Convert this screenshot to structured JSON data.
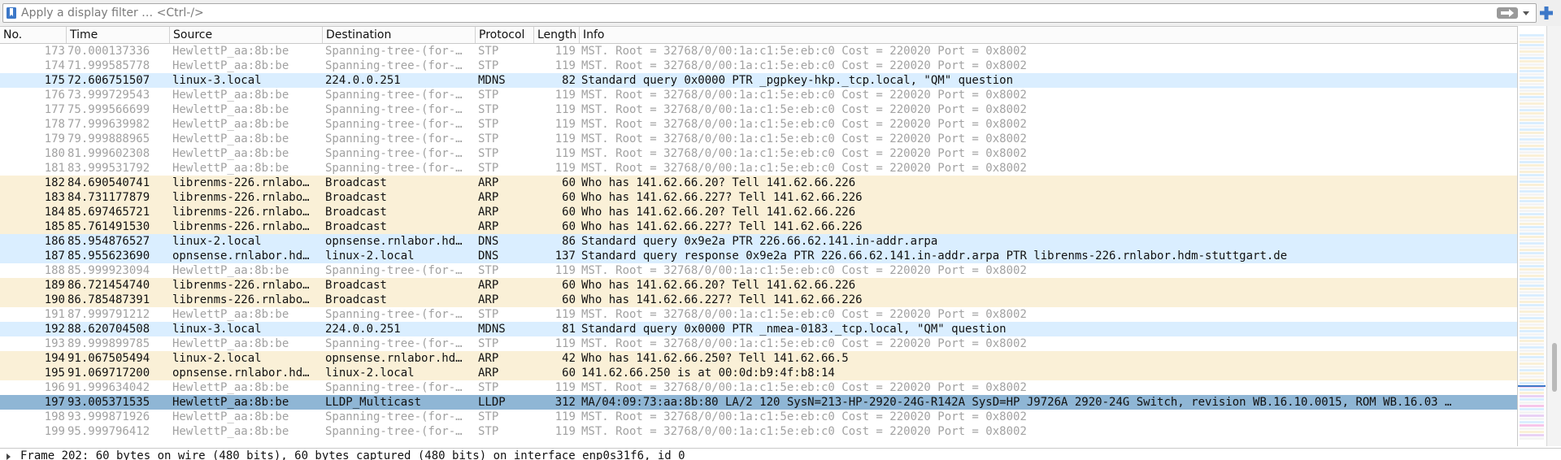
{
  "filter": {
    "placeholder": "Apply a display filter … <Ctrl-/>",
    "value": ""
  },
  "colors": {
    "stp_text": "#a2a2a2",
    "arp_bg": "#faf0d7",
    "udp_bg": "#daeeff",
    "selected_bg": "#8fb6d5"
  },
  "columns": {
    "no": "No.",
    "time": "Time",
    "source": "Source",
    "destination": "Destination",
    "protocol": "Protocol",
    "length": "Length",
    "info": "Info"
  },
  "packets": [
    {
      "no": "173",
      "time": "70.000137336",
      "source": "HewlettP_aa:8b:be",
      "destination": "Spanning-tree-(for-…",
      "protocol": "STP",
      "length": "119",
      "info": "MST. Root = 32768/0/00:1a:c1:5e:eb:c0  Cost = 220020  Port = 0x8002",
      "kind": "stp"
    },
    {
      "no": "174",
      "time": "71.999585778",
      "source": "HewlettP_aa:8b:be",
      "destination": "Spanning-tree-(for-…",
      "protocol": "STP",
      "length": "119",
      "info": "MST. Root = 32768/0/00:1a:c1:5e:eb:c0  Cost = 220020  Port = 0x8002",
      "kind": "stp"
    },
    {
      "no": "175",
      "time": "72.606751507",
      "source": "linux-3.local",
      "destination": "224.0.0.251",
      "protocol": "MDNS",
      "length": "82",
      "info": "Standard query 0x0000 PTR _pgpkey-hkp._tcp.local, \"QM\" question",
      "kind": "udp"
    },
    {
      "no": "176",
      "time": "73.999729543",
      "source": "HewlettP_aa:8b:be",
      "destination": "Spanning-tree-(for-…",
      "protocol": "STP",
      "length": "119",
      "info": "MST. Root = 32768/0/00:1a:c1:5e:eb:c0  Cost = 220020  Port = 0x8002",
      "kind": "stp"
    },
    {
      "no": "177",
      "time": "75.999566699",
      "source": "HewlettP_aa:8b:be",
      "destination": "Spanning-tree-(for-…",
      "protocol": "STP",
      "length": "119",
      "info": "MST. Root = 32768/0/00:1a:c1:5e:eb:c0  Cost = 220020  Port = 0x8002",
      "kind": "stp"
    },
    {
      "no": "178",
      "time": "77.999639982",
      "source": "HewlettP_aa:8b:be",
      "destination": "Spanning-tree-(for-…",
      "protocol": "STP",
      "length": "119",
      "info": "MST. Root = 32768/0/00:1a:c1:5e:eb:c0  Cost = 220020  Port = 0x8002",
      "kind": "stp"
    },
    {
      "no": "179",
      "time": "79.999888965",
      "source": "HewlettP_aa:8b:be",
      "destination": "Spanning-tree-(for-…",
      "protocol": "STP",
      "length": "119",
      "info": "MST. Root = 32768/0/00:1a:c1:5e:eb:c0  Cost = 220020  Port = 0x8002",
      "kind": "stp"
    },
    {
      "no": "180",
      "time": "81.999602308",
      "source": "HewlettP_aa:8b:be",
      "destination": "Spanning-tree-(for-…",
      "protocol": "STP",
      "length": "119",
      "info": "MST. Root = 32768/0/00:1a:c1:5e:eb:c0  Cost = 220020  Port = 0x8002",
      "kind": "stp"
    },
    {
      "no": "181",
      "time": "83.999531792",
      "source": "HewlettP_aa:8b:be",
      "destination": "Spanning-tree-(for-…",
      "protocol": "STP",
      "length": "119",
      "info": "MST. Root = 32768/0/00:1a:c1:5e:eb:c0  Cost = 220020  Port = 0x8002",
      "kind": "stp"
    },
    {
      "no": "182",
      "time": "84.690540741",
      "source": "librenms-226.rnlabo…",
      "destination": "Broadcast",
      "protocol": "ARP",
      "length": "60",
      "info": "Who has 141.62.66.20? Tell 141.62.66.226",
      "kind": "arp"
    },
    {
      "no": "183",
      "time": "84.731177879",
      "source": "librenms-226.rnlabo…",
      "destination": "Broadcast",
      "protocol": "ARP",
      "length": "60",
      "info": "Who has 141.62.66.227? Tell 141.62.66.226",
      "kind": "arp"
    },
    {
      "no": "184",
      "time": "85.697465721",
      "source": "librenms-226.rnlabo…",
      "destination": "Broadcast",
      "protocol": "ARP",
      "length": "60",
      "info": "Who has 141.62.66.20? Tell 141.62.66.226",
      "kind": "arp"
    },
    {
      "no": "185",
      "time": "85.761491530",
      "source": "librenms-226.rnlabo…",
      "destination": "Broadcast",
      "protocol": "ARP",
      "length": "60",
      "info": "Who has 141.62.66.227? Tell 141.62.66.226",
      "kind": "arp"
    },
    {
      "no": "186",
      "time": "85.954876527",
      "source": "linux-2.local",
      "destination": "opnsense.rnlabor.hd…",
      "protocol": "DNS",
      "length": "86",
      "info": "Standard query 0x9e2a PTR 226.66.62.141.in-addr.arpa",
      "kind": "udp"
    },
    {
      "no": "187",
      "time": "85.955623690",
      "source": "opnsense.rnlabor.hd…",
      "destination": "linux-2.local",
      "protocol": "DNS",
      "length": "137",
      "info": "Standard query response 0x9e2a PTR 226.66.62.141.in-addr.arpa PTR librenms-226.rnlabor.hdm-stuttgart.de",
      "kind": "udp"
    },
    {
      "no": "188",
      "time": "85.999923094",
      "source": "HewlettP_aa:8b:be",
      "destination": "Spanning-tree-(for-…",
      "protocol": "STP",
      "length": "119",
      "info": "MST. Root = 32768/0/00:1a:c1:5e:eb:c0  Cost = 220020  Port = 0x8002",
      "kind": "stp"
    },
    {
      "no": "189",
      "time": "86.721454740",
      "source": "librenms-226.rnlabo…",
      "destination": "Broadcast",
      "protocol": "ARP",
      "length": "60",
      "info": "Who has 141.62.66.20? Tell 141.62.66.226",
      "kind": "arp"
    },
    {
      "no": "190",
      "time": "86.785487391",
      "source": "librenms-226.rnlabo…",
      "destination": "Broadcast",
      "protocol": "ARP",
      "length": "60",
      "info": "Who has 141.62.66.227? Tell 141.62.66.226",
      "kind": "arp"
    },
    {
      "no": "191",
      "time": "87.999791212",
      "source": "HewlettP_aa:8b:be",
      "destination": "Spanning-tree-(for-…",
      "protocol": "STP",
      "length": "119",
      "info": "MST. Root = 32768/0/00:1a:c1:5e:eb:c0  Cost = 220020  Port = 0x8002",
      "kind": "stp"
    },
    {
      "no": "192",
      "time": "88.620704508",
      "source": "linux-3.local",
      "destination": "224.0.0.251",
      "protocol": "MDNS",
      "length": "81",
      "info": "Standard query 0x0000 PTR _nmea-0183._tcp.local, \"QM\" question",
      "kind": "udp"
    },
    {
      "no": "193",
      "time": "89.999899785",
      "source": "HewlettP_aa:8b:be",
      "destination": "Spanning-tree-(for-…",
      "protocol": "STP",
      "length": "119",
      "info": "MST. Root = 32768/0/00:1a:c1:5e:eb:c0  Cost = 220020  Port = 0x8002",
      "kind": "stp"
    },
    {
      "no": "194",
      "time": "91.067505494",
      "source": "linux-2.local",
      "destination": "opnsense.rnlabor.hd…",
      "protocol": "ARP",
      "length": "42",
      "info": "Who has 141.62.66.250? Tell 141.62.66.5",
      "kind": "arp"
    },
    {
      "no": "195",
      "time": "91.069717200",
      "source": "opnsense.rnlabor.hd…",
      "destination": "linux-2.local",
      "protocol": "ARP",
      "length": "60",
      "info": "141.62.66.250 is at 00:0d:b9:4f:b8:14",
      "kind": "arp"
    },
    {
      "no": "196",
      "time": "91.999634042",
      "source": "HewlettP_aa:8b:be",
      "destination": "Spanning-tree-(for-…",
      "protocol": "STP",
      "length": "119",
      "info": "MST. Root = 32768/0/00:1a:c1:5e:eb:c0  Cost = 220020  Port = 0x8002",
      "kind": "stp"
    },
    {
      "no": "197",
      "time": "93.005371535",
      "source": "HewlettP_aa:8b:be",
      "destination": "LLDP_Multicast",
      "protocol": "LLDP",
      "length": "312",
      "info": "MA/04:09:73:aa:8b:80 LA/2 120 SysN=213-HP-2920-24G-R142A SysD=HP J9726A 2920-24G Switch, revision WB.16.10.0015, ROM WB.16.03 …",
      "kind": "sel"
    },
    {
      "no": "198",
      "time": "93.999871926",
      "source": "HewlettP_aa:8b:be",
      "destination": "Spanning-tree-(for-…",
      "protocol": "STP",
      "length": "119",
      "info": "MST. Root = 32768/0/00:1a:c1:5e:eb:c0  Cost = 220020  Port = 0x8002",
      "kind": "stp"
    },
    {
      "no": "199",
      "time": "95.999796412",
      "source": "HewlettP_aa:8b:be",
      "destination": "Spanning-tree-(for-…",
      "protocol": "STP",
      "length": "119",
      "info": "MST. Root = 32768/0/00:1a:c1:5e:eb:c0  Cost = 220020  Port = 0x8002",
      "kind": "stp"
    }
  ],
  "details": {
    "frame_summary": "Frame 202: 60 bytes on wire (480 bits), 60 bytes captured (480 bits) on interface enp0s31f6, id 0"
  }
}
